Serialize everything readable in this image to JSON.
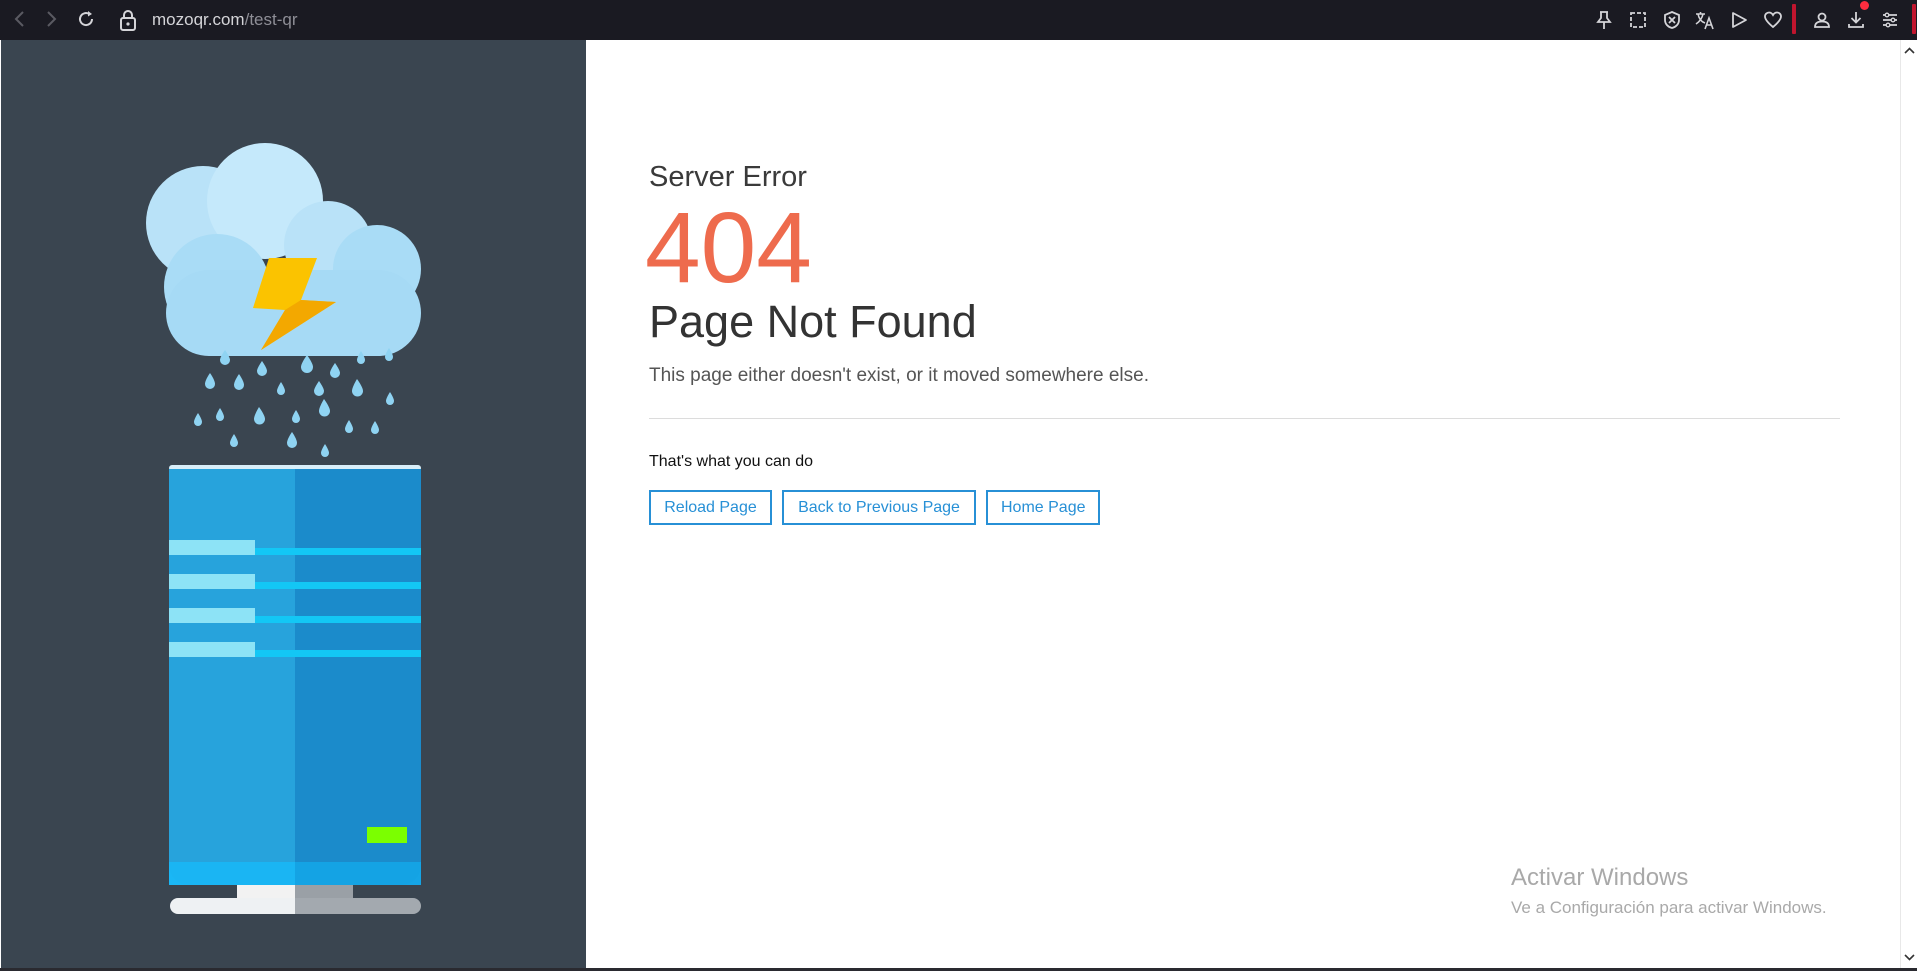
{
  "browser": {
    "url_host": "mozoqr.com",
    "url_path": "/test-qr",
    "icons": [
      "back-icon",
      "forward-icon",
      "reload-icon",
      "lock-icon",
      "pin-icon",
      "screenshot-icon",
      "shield-icon",
      "translate-icon",
      "send-icon",
      "heart-icon",
      "profile-icon",
      "download-icon",
      "menu-icon"
    ],
    "accent": "#c0152e"
  },
  "page": {
    "heading_small": "Server Error",
    "code": "404",
    "title": "Page Not Found",
    "description": "This page either doesn't exist, or it moved somewhere else.",
    "actions_label": "That's what you can do",
    "buttons": {
      "reload": "Reload Page",
      "back": "Back to Previous Page",
      "home": "Home Page"
    },
    "colors": {
      "code": "#ee6b4d",
      "button": "#2790d6",
      "panel": "#3a4550"
    }
  },
  "watermark": {
    "title": "Activar Windows",
    "subtitle": "Ve a Configuración para activar Windows."
  }
}
